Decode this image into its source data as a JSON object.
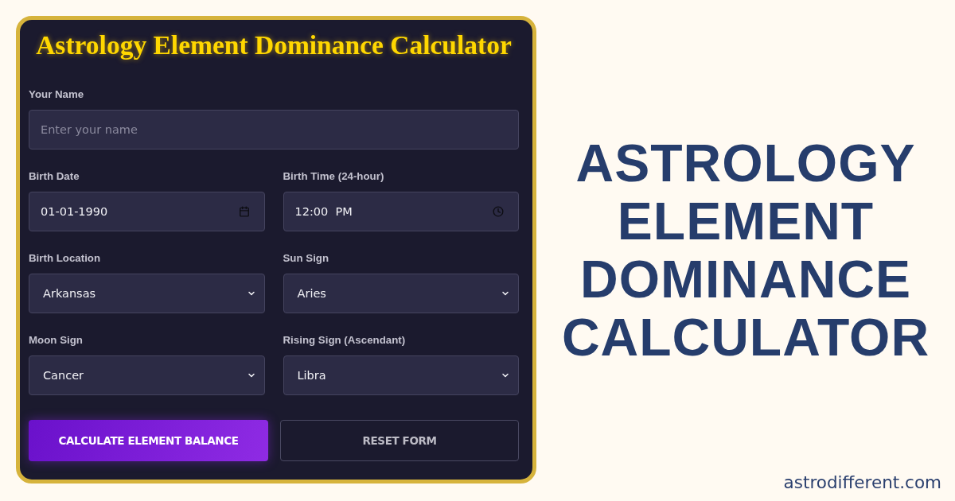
{
  "card": {
    "title": "Astrology Element Dominance Calculator",
    "name_field": {
      "kind": "text",
      "label": "Your Name",
      "placeholder": "Enter your name"
    },
    "fields": [
      {
        "kind": "date",
        "label": "Birth Date",
        "value": "01-01-1990"
      },
      {
        "kind": "time",
        "label": "Birth Time (24-hour)",
        "value": "12:00  PM"
      },
      {
        "kind": "select",
        "label": "Birth Location",
        "value": "Arkansas"
      },
      {
        "kind": "select",
        "label": "Sun Sign",
        "value": "Aries"
      },
      {
        "kind": "select",
        "label": "Moon Sign",
        "value": "Cancer"
      },
      {
        "kind": "select",
        "label": "Rising Sign (Ascendant)",
        "value": "Libra"
      }
    ],
    "buttons": [
      {
        "kind": "primary",
        "label": "CALCULATE ELEMENT BALANCE"
      },
      {
        "kind": "secondary",
        "label": "RESET FORM"
      }
    ]
  },
  "headline": [
    "ASTROLOGY",
    "ELEMENT",
    "DOMINANCE",
    "CALCULATOR"
  ],
  "website": "astrodifferent.com"
}
